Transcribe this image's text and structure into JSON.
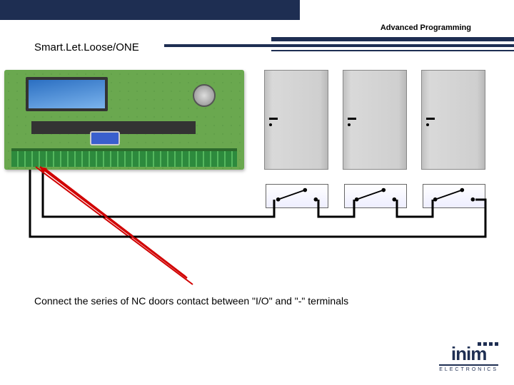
{
  "header": {
    "tag": "Advanced Programming",
    "subtitle": "Smart.Let.Loose/ONE"
  },
  "body": {
    "text": "Connect the series of NC doors contact between \"I/O\" and \"-\" terminals"
  },
  "logo": {
    "name": "inim",
    "sub": "ELECTRONICS"
  },
  "colors": {
    "brand": "#1e2e52",
    "pcb": "#6aa84f",
    "pointer": "#d10000"
  }
}
